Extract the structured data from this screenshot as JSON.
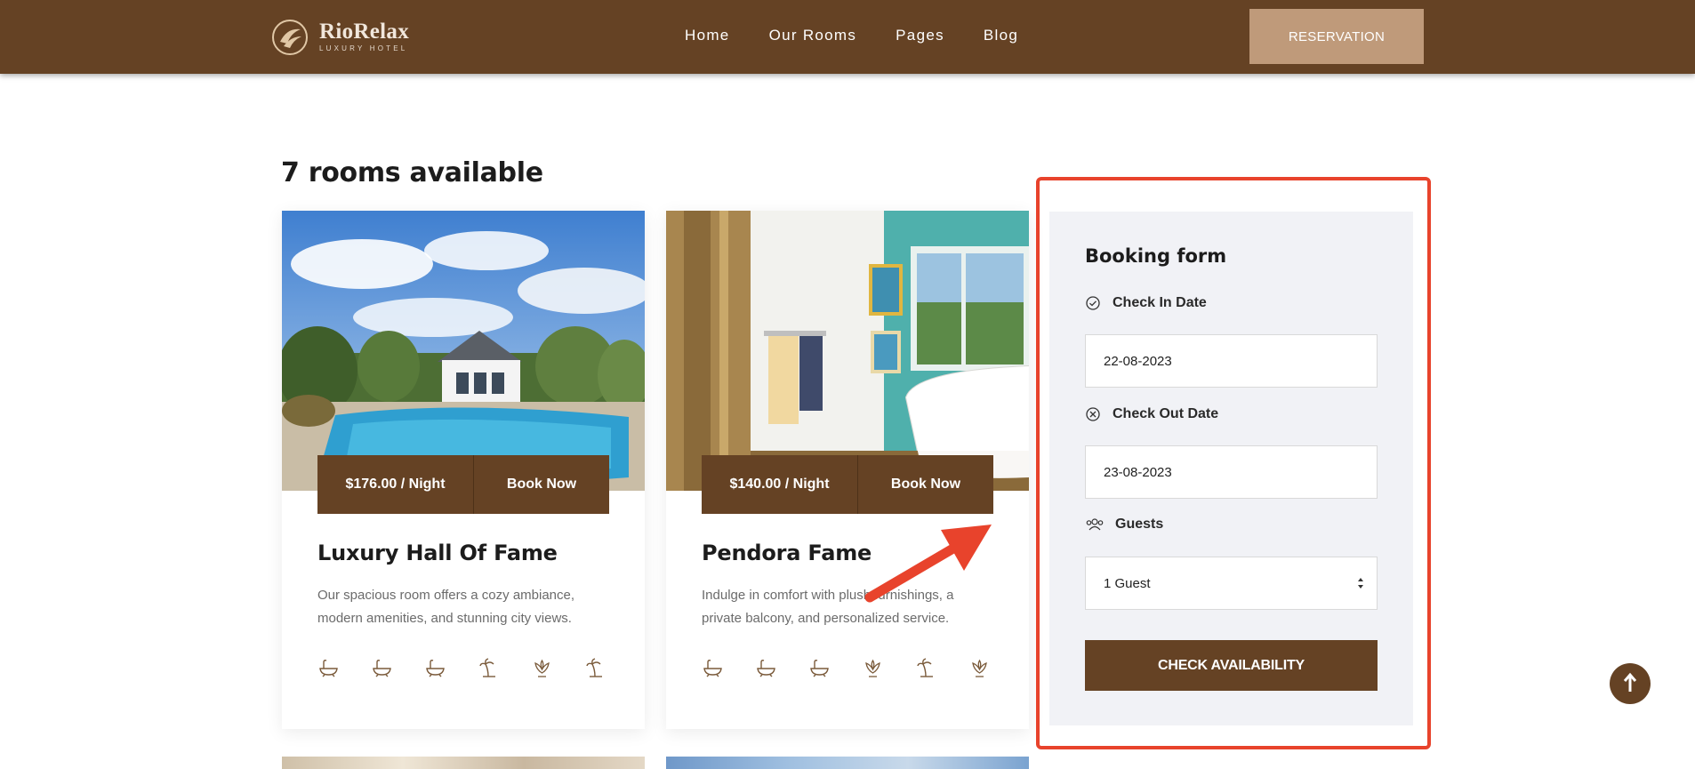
{
  "header": {
    "logo_name": "RioRelax",
    "logo_tagline": "LUXURY HOTEL",
    "nav": [
      "Home",
      "Our Rooms",
      "Pages",
      "Blog"
    ],
    "reservation_label": "RESERVATION"
  },
  "rooms": {
    "title": "7 rooms available",
    "cards": [
      {
        "price": "$176.00 / Night",
        "book": "Book Now",
        "name": "Luxury Hall Of Fame",
        "description": "Our spacious room offers a cozy ambiance, modern amenities, and stunning city views."
      },
      {
        "price": "$140.00 / Night",
        "book": "Book Now",
        "name": "Pendora Fame",
        "description": "Indulge in comfort with plush furnishings, a private balcony, and personalized service."
      }
    ]
  },
  "booking": {
    "title": "Booking form",
    "check_in_label": "Check In Date",
    "check_in_value": "22-08-2023",
    "check_out_label": "Check Out Date",
    "check_out_value": "23-08-2023",
    "guests_label": "Guests",
    "guests_value": "1 Guest",
    "button": "CHECK AVAILABILITY"
  },
  "colors": {
    "brand": "#654224",
    "accent": "#bf9a7a",
    "highlight": "#e8432c"
  }
}
